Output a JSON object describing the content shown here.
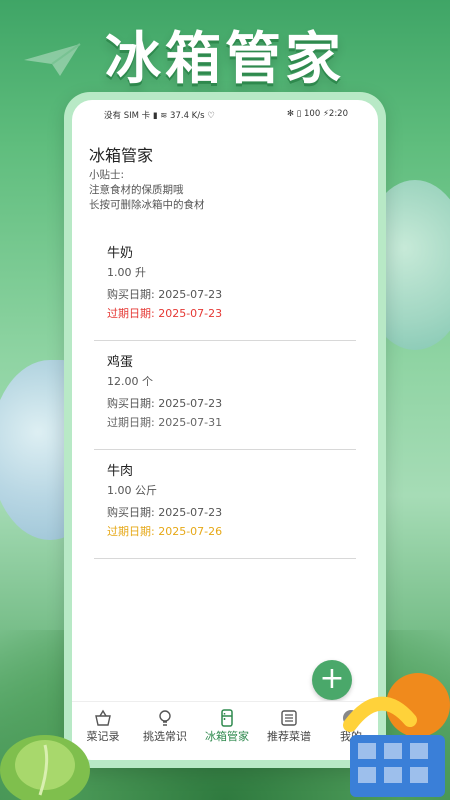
{
  "banner": {
    "title": "冰箱管家"
  },
  "status": {
    "left": "没有 SIM 卡 ▮ ≋ 37.4 K/s ♡",
    "right": "✻ ▯ 100 ⚡2:20"
  },
  "app": {
    "title": "冰箱管家",
    "tips": [
      "小贴士:",
      "注意食材的保质期哦",
      "长按可删除冰箱中的食材"
    ]
  },
  "items": [
    {
      "name": "牛奶",
      "qty": "1.00 升",
      "buy": "购买日期: 2025-07-23",
      "exp": "过期日期: 2025-07-23",
      "exp_color": "#e53935"
    },
    {
      "name": "鸡蛋",
      "qty": "12.00 个",
      "buy": "购买日期: 2025-07-23",
      "exp": "过期日期: 2025-07-31",
      "exp_color": "#666666"
    },
    {
      "name": "牛肉",
      "qty": "1.00 公斤",
      "buy": "购买日期: 2025-07-23",
      "exp": "过期日期: 2025-07-26",
      "exp_color": "#e6a817"
    }
  ],
  "fab": {
    "label": "+"
  },
  "tabs": [
    {
      "label": "菜记录",
      "icon": "basket-icon"
    },
    {
      "label": "挑选常识",
      "icon": "lightbulb-icon"
    },
    {
      "label": "冰箱管家",
      "icon": "fridge-icon"
    },
    {
      "label": "推荐菜谱",
      "icon": "list-icon"
    },
    {
      "label": "我的",
      "icon": "user-icon"
    }
  ],
  "colors": {
    "accent": "#2f8a4e",
    "fab": "#4aa86a",
    "expired": "#e53935",
    "warning": "#e6a817"
  }
}
